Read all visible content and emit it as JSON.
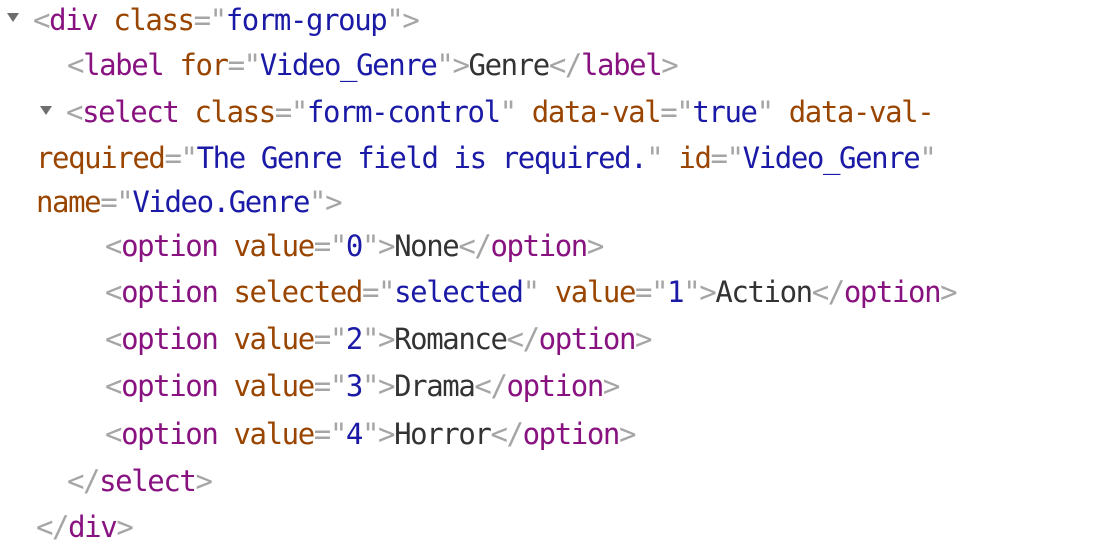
{
  "elements_tree": {
    "lines": [
      {
        "expandable": true,
        "tokens": [
          {
            "t": "punct",
            "v": "<"
          },
          {
            "t": "tag",
            "v": "div"
          },
          {
            "t": "txt",
            "v": " "
          },
          {
            "t": "attr",
            "v": "class"
          },
          {
            "t": "punct",
            "v": "=\""
          },
          {
            "t": "val",
            "v": "form-group"
          },
          {
            "t": "punct",
            "v": "\">"
          }
        ]
      },
      {
        "expandable": false,
        "tokens": [
          {
            "t": "punct",
            "v": "<"
          },
          {
            "t": "tag",
            "v": "label"
          },
          {
            "t": "txt",
            "v": " "
          },
          {
            "t": "attr",
            "v": "for"
          },
          {
            "t": "punct",
            "v": "=\""
          },
          {
            "t": "val",
            "v": "Video_Genre"
          },
          {
            "t": "punct",
            "v": "\">"
          },
          {
            "t": "txt",
            "v": "Genre"
          },
          {
            "t": "punct",
            "v": "</"
          },
          {
            "t": "tag",
            "v": "label"
          },
          {
            "t": "punct",
            "v": ">"
          }
        ]
      },
      {
        "expandable": true,
        "tokens": [
          {
            "t": "punct",
            "v": "<"
          },
          {
            "t": "tag",
            "v": "select"
          },
          {
            "t": "txt",
            "v": " "
          },
          {
            "t": "attr",
            "v": "class"
          },
          {
            "t": "punct",
            "v": "=\""
          },
          {
            "t": "val",
            "v": "form-control"
          },
          {
            "t": "punct",
            "v": "\""
          },
          {
            "t": "txt",
            "v": " "
          },
          {
            "t": "attr",
            "v": "data-val"
          },
          {
            "t": "punct",
            "v": "=\""
          },
          {
            "t": "val",
            "v": "true"
          },
          {
            "t": "punct",
            "v": "\""
          },
          {
            "t": "txt",
            "v": " "
          },
          {
            "t": "attr",
            "v": "data-val-"
          }
        ]
      },
      {
        "expandable": false,
        "tokens": [
          {
            "t": "attr",
            "v": "required"
          },
          {
            "t": "punct",
            "v": "=\""
          },
          {
            "t": "val",
            "v": "The Genre field is required."
          },
          {
            "t": "punct",
            "v": "\""
          },
          {
            "t": "txt",
            "v": " "
          },
          {
            "t": "attr",
            "v": "id"
          },
          {
            "t": "punct",
            "v": "=\""
          },
          {
            "t": "val",
            "v": "Video_Genre"
          },
          {
            "t": "punct",
            "v": "\""
          }
        ]
      },
      {
        "expandable": false,
        "tokens": [
          {
            "t": "attr",
            "v": "name"
          },
          {
            "t": "punct",
            "v": "=\""
          },
          {
            "t": "val",
            "v": "Video.Genre"
          },
          {
            "t": "punct",
            "v": "\">"
          }
        ]
      },
      {
        "expandable": false,
        "tokens": [
          {
            "t": "punct",
            "v": "<"
          },
          {
            "t": "tag",
            "v": "option"
          },
          {
            "t": "txt",
            "v": " "
          },
          {
            "t": "attr",
            "v": "value"
          },
          {
            "t": "punct",
            "v": "=\""
          },
          {
            "t": "val",
            "v": "0"
          },
          {
            "t": "punct",
            "v": "\">"
          },
          {
            "t": "txt",
            "v": "None"
          },
          {
            "t": "punct",
            "v": "</"
          },
          {
            "t": "tag",
            "v": "option"
          },
          {
            "t": "punct",
            "v": ">"
          }
        ]
      },
      {
        "expandable": false,
        "tokens": [
          {
            "t": "punct",
            "v": "<"
          },
          {
            "t": "tag",
            "v": "option"
          },
          {
            "t": "txt",
            "v": " "
          },
          {
            "t": "attr",
            "v": "selected"
          },
          {
            "t": "punct",
            "v": "=\""
          },
          {
            "t": "val",
            "v": "selected"
          },
          {
            "t": "punct",
            "v": "\""
          },
          {
            "t": "txt",
            "v": " "
          },
          {
            "t": "attr",
            "v": "value"
          },
          {
            "t": "punct",
            "v": "=\""
          },
          {
            "t": "val",
            "v": "1"
          },
          {
            "t": "punct",
            "v": "\">"
          },
          {
            "t": "txt",
            "v": "Action"
          },
          {
            "t": "punct",
            "v": "</"
          },
          {
            "t": "tag",
            "v": "option"
          },
          {
            "t": "punct",
            "v": ">"
          }
        ]
      },
      {
        "expandable": false,
        "tokens": [
          {
            "t": "punct",
            "v": "<"
          },
          {
            "t": "tag",
            "v": "option"
          },
          {
            "t": "txt",
            "v": " "
          },
          {
            "t": "attr",
            "v": "value"
          },
          {
            "t": "punct",
            "v": "=\""
          },
          {
            "t": "val",
            "v": "2"
          },
          {
            "t": "punct",
            "v": "\">"
          },
          {
            "t": "txt",
            "v": "Romance"
          },
          {
            "t": "punct",
            "v": "</"
          },
          {
            "t": "tag",
            "v": "option"
          },
          {
            "t": "punct",
            "v": ">"
          }
        ]
      },
      {
        "expandable": false,
        "tokens": [
          {
            "t": "punct",
            "v": "<"
          },
          {
            "t": "tag",
            "v": "option"
          },
          {
            "t": "txt",
            "v": " "
          },
          {
            "t": "attr",
            "v": "value"
          },
          {
            "t": "punct",
            "v": "=\""
          },
          {
            "t": "val",
            "v": "3"
          },
          {
            "t": "punct",
            "v": "\">"
          },
          {
            "t": "txt",
            "v": "Drama"
          },
          {
            "t": "punct",
            "v": "</"
          },
          {
            "t": "tag",
            "v": "option"
          },
          {
            "t": "punct",
            "v": ">"
          }
        ]
      },
      {
        "expandable": false,
        "tokens": [
          {
            "t": "punct",
            "v": "<"
          },
          {
            "t": "tag",
            "v": "option"
          },
          {
            "t": "txt",
            "v": " "
          },
          {
            "t": "attr",
            "v": "value"
          },
          {
            "t": "punct",
            "v": "=\""
          },
          {
            "t": "val",
            "v": "4"
          },
          {
            "t": "punct",
            "v": "\">"
          },
          {
            "t": "txt",
            "v": "Horror"
          },
          {
            "t": "punct",
            "v": "</"
          },
          {
            "t": "tag",
            "v": "option"
          },
          {
            "t": "punct",
            "v": ">"
          }
        ]
      },
      {
        "expandable": false,
        "tokens": [
          {
            "t": "punct",
            "v": "</"
          },
          {
            "t": "tag",
            "v": "select"
          },
          {
            "t": "punct",
            "v": ">"
          }
        ]
      },
      {
        "expandable": false,
        "tokens": [
          {
            "t": "punct",
            "v": "</"
          },
          {
            "t": "tag",
            "v": "div"
          },
          {
            "t": "punct",
            "v": ">"
          }
        ]
      }
    ]
  },
  "colors": {
    "tag": "#881280",
    "attribute": "#994500",
    "value": "#1a1aa6",
    "punctuation": "#a5a5a5",
    "text": "#333333",
    "disclosure_triangle": "#6e6e6e"
  }
}
